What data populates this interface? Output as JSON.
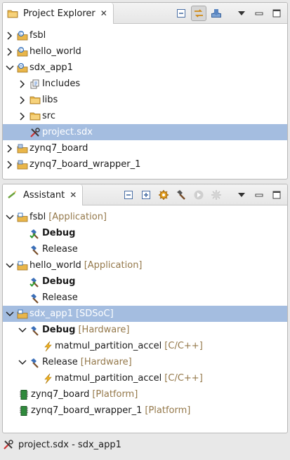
{
  "project_explorer": {
    "title": "Project Explorer",
    "close": "✕",
    "items": [
      {
        "label": "fsbl"
      },
      {
        "label": "hello_world"
      },
      {
        "label": "sdx_app1"
      },
      {
        "label": "Includes"
      },
      {
        "label": "libs"
      },
      {
        "label": "src"
      },
      {
        "label": "project.sdx"
      },
      {
        "label": "zynq7_board"
      },
      {
        "label": "zynq7_board_wrapper_1"
      }
    ]
  },
  "assistant": {
    "title": "Assistant",
    "close": "✕",
    "items": [
      {
        "label": "fsbl",
        "decoration": "[Application]"
      },
      {
        "label": "Debug"
      },
      {
        "label": "Release"
      },
      {
        "label": "hello_world",
        "decoration": "[Application]"
      },
      {
        "label": "Debug"
      },
      {
        "label": "Release"
      },
      {
        "label": "sdx_app1",
        "decoration": "[SDSoC]"
      },
      {
        "label": "Debug",
        "decoration": "[Hardware]"
      },
      {
        "label": "matmul_partition_accel",
        "decoration": "[C/C++]"
      },
      {
        "label": "Release",
        "decoration": "[Hardware]"
      },
      {
        "label": "matmul_partition_accel",
        "decoration": "[C/C++]"
      },
      {
        "label": "zynq7_board",
        "decoration": "[Platform]"
      },
      {
        "label": "zynq7_board_wrapper_1",
        "decoration": "[Platform]"
      }
    ]
  },
  "status": {
    "text": "project.sdx - sdx_app1"
  },
  "colors": {
    "selection": "#a4bde0",
    "decoration": "#94784a",
    "folder": "#e9b64a"
  }
}
